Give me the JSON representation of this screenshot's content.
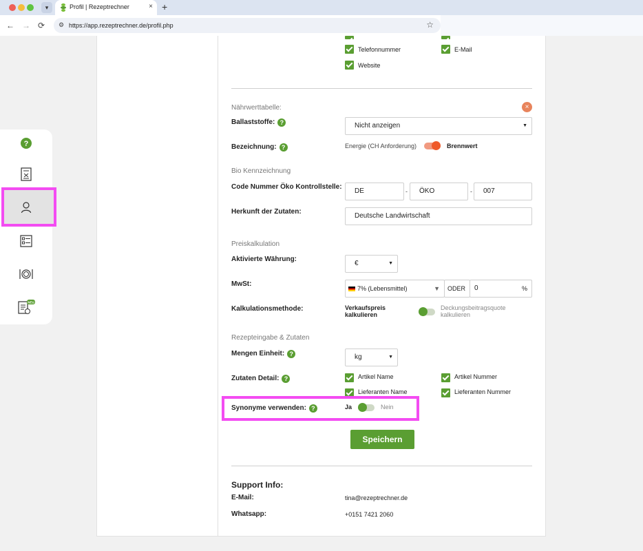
{
  "browser": {
    "tab_title": "Profil | Rezeptrechner",
    "tab_close": "×",
    "new_tab": "+",
    "url": "https://app.rezeptrechner.de/profil.php",
    "back": "←",
    "forward": "→",
    "reload": "⟳",
    "bookmark": "☆"
  },
  "sidebar": {
    "items": [
      {
        "icon": "help-circle-icon"
      },
      {
        "icon": "recipe-document-icon"
      },
      {
        "icon": "user-profile-icon",
        "active": true
      },
      {
        "icon": "checklist-icon"
      },
      {
        "icon": "plate-cutlery-icon"
      },
      {
        "icon": "clipboard-clock-icon",
        "badge": "NEU"
      }
    ]
  },
  "contact_checkboxes": {
    "telefon": "Telefonnummer",
    "email": "E-Mail",
    "website": "Website"
  },
  "naehrwert": {
    "section": "Nährwerttabelle:",
    "close": "×",
    "ballaststoffe_label": "Ballaststoffe:",
    "ballaststoffe_value": "Nicht anzeigen",
    "bezeichnung_label": "Bezeichnung:",
    "bezeichnung_left": "Energie (CH Anforderung)",
    "bezeichnung_right": "Brennwert"
  },
  "bio": {
    "section": "Bio Kennzeichnung",
    "code_label": "Code Nummer Öko Kontrollstelle:",
    "code_1": "DE",
    "code_2": "ÖKO",
    "code_3": "007",
    "dash": "-",
    "herkunft_label": "Herkunft der Zutaten:",
    "herkunft_value": "Deutsche Landwirtschaft"
  },
  "preis": {
    "section": "Preiskalkulation",
    "waehrung_label": "Aktivierte Währung:",
    "waehrung_value": "€",
    "mwst_label": "MwSt:",
    "mwst_value": "7% (Lebensmittel)",
    "oder": "ODER",
    "mwst_custom": "0",
    "percent": "%",
    "methode_label": "Kalkulationsmethode:",
    "methode_left_1": "Verkaufspreis",
    "methode_left_2": "kalkulieren",
    "methode_right_1": "Deckungsbeitragsquote",
    "methode_right_2": "kalkulieren"
  },
  "rezept": {
    "section": "Rezepteingabe & Zutaten",
    "einheit_label": "Mengen Einheit:",
    "einheit_value": "kg",
    "detail_label": "Zutaten Detail:",
    "artikel_name": "Artikel Name",
    "artikel_nummer": "Artikel Nummer",
    "lieferanten_name": "Lieferanten Name",
    "lieferanten_nummer": "Lieferanten Nummer",
    "synonyme_label": "Synonyme verwenden:",
    "ja": "Ja",
    "nein": "Nein"
  },
  "save_label": "Speichern",
  "support": {
    "title": "Support Info:",
    "email_label": "E-Mail:",
    "email_value": "tina@rezeptrechner.de",
    "whatsapp_label": "Whatsapp:",
    "whatsapp_value": "+0151 7421 2060"
  },
  "colors": {
    "accent_green": "#5a9e32",
    "highlight_magenta": "#f34cf2",
    "toggle_orange": "#ef5a2a"
  }
}
